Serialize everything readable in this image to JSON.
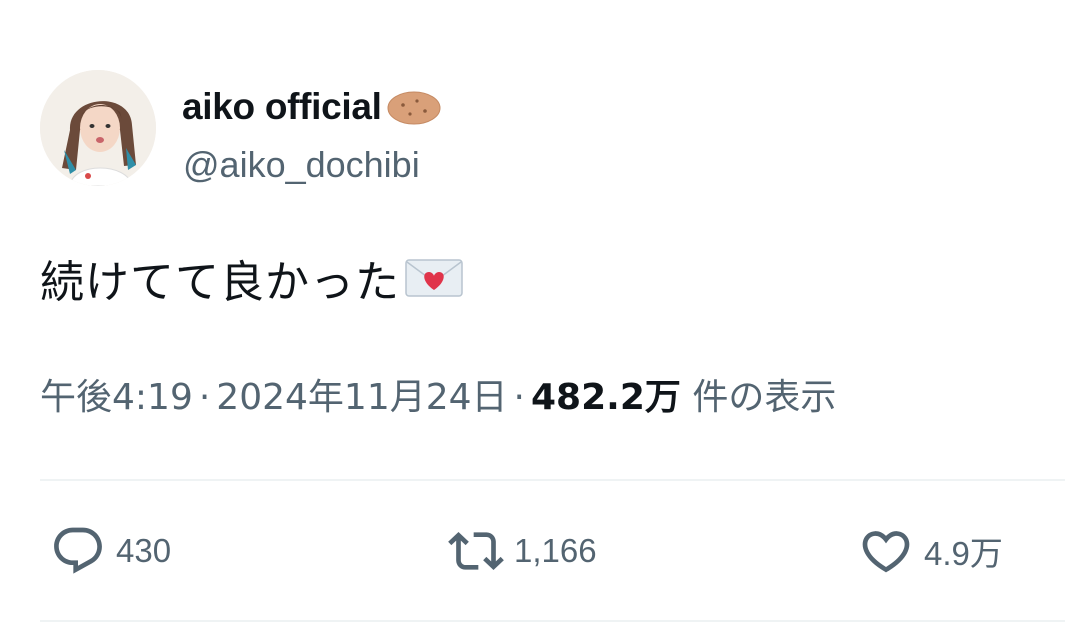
{
  "author": {
    "display_name": "aiko official",
    "name_emoji": "potato-emoji",
    "handle": "@aiko_dochibi",
    "avatar": "profile-photo"
  },
  "post": {
    "text": "続けてて良かった",
    "emoji": "love-letter-emoji"
  },
  "meta": {
    "time": "午後4:19",
    "separator": "·",
    "date": "2024年11月24日",
    "views_count": "482.2万",
    "views_label": "件の表示"
  },
  "actions": {
    "reply": {
      "icon": "reply-icon",
      "count": "430"
    },
    "retweet": {
      "icon": "retweet-icon",
      "count": "1,166"
    },
    "like": {
      "icon": "heart-icon",
      "count": "4.9万"
    }
  },
  "colors": {
    "text_primary": "#0f1419",
    "text_secondary": "#536471",
    "divider": "#eff3f4"
  }
}
